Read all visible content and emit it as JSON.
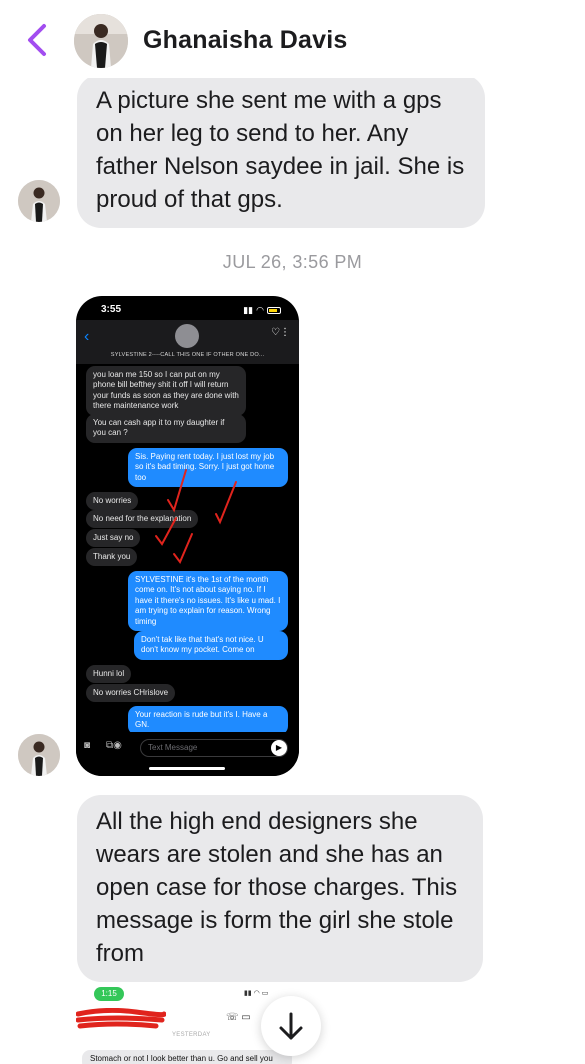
{
  "header": {
    "contact_name": "Ghanaisha Davis"
  },
  "messages": {
    "m1": "A picture she sent me with a gps on her leg to send to her. Any father Nelson saydee in jail. She is proud of that gps.",
    "timestamp": "JUL 26, 3:56 PM",
    "m2": "All the high end designers she wears are stolen and she has an open case for those charges. This message is form the girl she stole from"
  },
  "screenshot1": {
    "time": "3:55",
    "contact": "SYLVESTINE 2----CALL THIS ONE IF OTHER ONE DO...",
    "input_placeholder": "Text Message",
    "bubbles": [
      {
        "dir": "in",
        "text": "you loan me 150 so I can put on my phone bill befthey shit it off I will return your funds as soon as they are done with there maintenance work"
      },
      {
        "dir": "in",
        "text": "You can cash app it to my daughter if you can ?"
      },
      {
        "dir": "out",
        "text": "Sis. Paying rent today. I just lost my job so it's bad timing.  Sorry. I just got home too"
      },
      {
        "dir": "in",
        "text": "No worries"
      },
      {
        "dir": "in",
        "text": "No need for the explanation"
      },
      {
        "dir": "in",
        "text": "Just say no"
      },
      {
        "dir": "in",
        "text": "Thank you"
      },
      {
        "dir": "out",
        "text": "SYLVESTINE it's the 1st of the month come on. It's not about saying no. If I have it there's no issues. It's like u mad. I am trying to explain for reason. Wrong timing"
      },
      {
        "dir": "out",
        "text": "Don't tak like that that's not nice. U don't know my pocket.  Come on"
      },
      {
        "dir": "in",
        "text": "Hunni lol"
      },
      {
        "dir": "in",
        "text": "No worries CHrislove"
      },
      {
        "dir": "out",
        "text": "Your reaction is rude but it's I. Have a GN."
      }
    ]
  },
  "screenshot2": {
    "time": "1:15",
    "divider": "YESTERDAY",
    "bubble": "Stomach or not I look better than u. Go and sell you"
  },
  "icons": {
    "back": "chevron-left-icon",
    "scroll_down": "arrow-down-icon"
  },
  "colors": {
    "accent": "#a24df0",
    "incoming_bubble": "#e9e9eb",
    "imessage_blue": "#1f8bff"
  }
}
